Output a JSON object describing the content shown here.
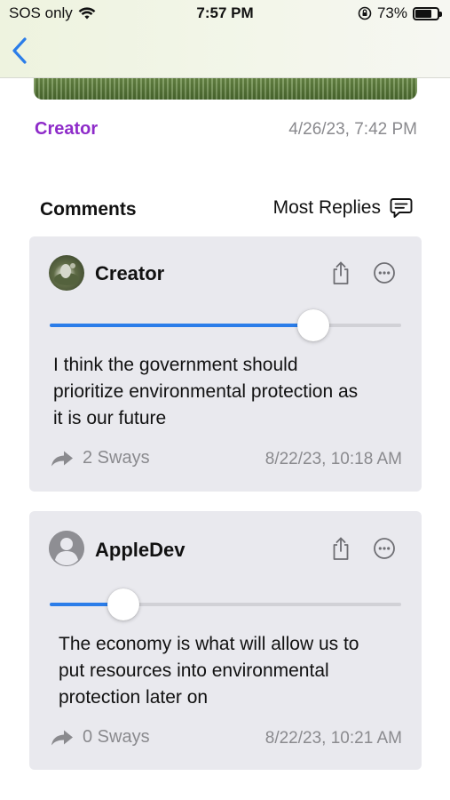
{
  "status_bar": {
    "carrier": "SOS only",
    "time": "7:57 PM",
    "battery": "73%",
    "battery_level": 0.73
  },
  "nav": {
    "back_icon": "chevron-left-icon"
  },
  "post": {
    "author": "Creator",
    "date": "4/26/23, 7:42 PM"
  },
  "comments": {
    "title": "Comments",
    "sort_label": "Most Replies",
    "sort_icon": "speech-bubble-icon",
    "items": [
      {
        "username": "Creator",
        "avatar": "photo-avatar",
        "slider_value": 0.75,
        "text_lines": [
          "I think the government should",
          "prioritize environmental protection as",
          "it is our future"
        ],
        "sways": "2 Sways",
        "timestamp": "8/22/23, 10:18 AM"
      },
      {
        "username": "AppleDev",
        "avatar": "person-circle-icon",
        "slider_value": 0.21,
        "text_lines": [
          "The economy is what will allow us to",
          "put resources into environmental",
          "protection later on"
        ],
        "sways": "0 Sways",
        "timestamp": "8/22/23, 10:21 AM"
      }
    ]
  },
  "colors": {
    "accent": "#2b7de9",
    "author": "#8e2bc9",
    "card_bg": "#e9e9ee",
    "secondary_text": "#8a8a8e"
  }
}
